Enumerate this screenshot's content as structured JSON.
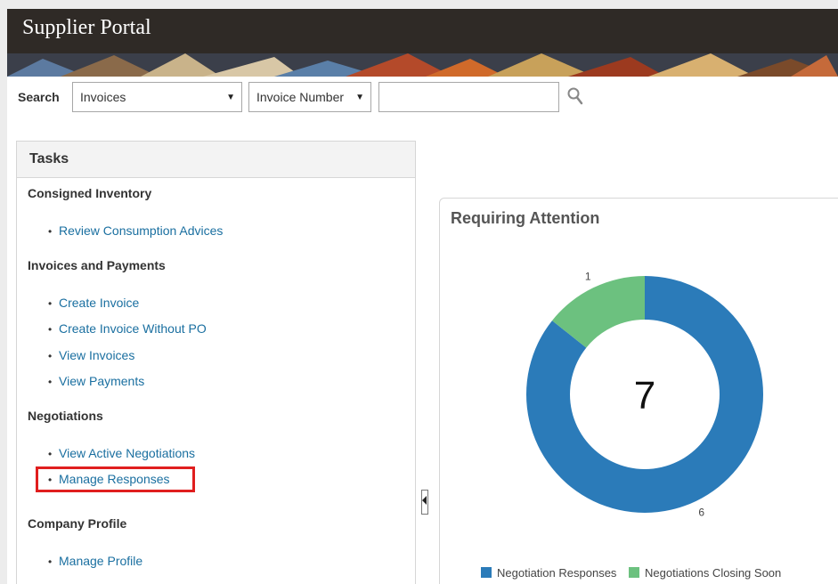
{
  "header": {
    "title": "Supplier Portal"
  },
  "search": {
    "label": "Search",
    "object_select": "Invoices",
    "attribute_select": "Invoice Number",
    "input_value": ""
  },
  "tasks": {
    "title": "Tasks",
    "groups": [
      {
        "title": "Consigned Inventory",
        "items": [
          "Review Consumption Advices"
        ]
      },
      {
        "title": "Invoices and Payments",
        "items": [
          "Create Invoice",
          "Create Invoice Without PO",
          "View Invoices",
          "View Payments"
        ]
      },
      {
        "title": "Negotiations",
        "items": [
          "View Active Negotiations",
          "Manage Responses"
        ]
      },
      {
        "title": "Company Profile",
        "items": [
          "Manage Profile"
        ]
      }
    ],
    "highlighted_item": "Manage Responses"
  },
  "attention": {
    "title": "Requiring Attention",
    "total": "7"
  },
  "chart_data": {
    "type": "pie",
    "categories": [
      "Negotiation Responses",
      "Negotiations Closing Soon"
    ],
    "values": [
      6,
      1
    ],
    "series": [
      {
        "name": "Negotiation Responses",
        "values": [
          6
        ]
      },
      {
        "name": "Negotiations Closing Soon",
        "values": [
          1
        ]
      }
    ],
    "slice_labels": [
      "6",
      "1"
    ],
    "center_label": "7",
    "colors": [
      "#2b7bb9",
      "#6cc17f"
    ],
    "legend_position": "bottom"
  },
  "colors": {
    "header_bg": "#2f2a26",
    "link": "#1a6fa0",
    "highlight": "#e01e1e"
  },
  "icons": {
    "search": "magnifier-icon",
    "splitter": "collapse-left-icon"
  }
}
